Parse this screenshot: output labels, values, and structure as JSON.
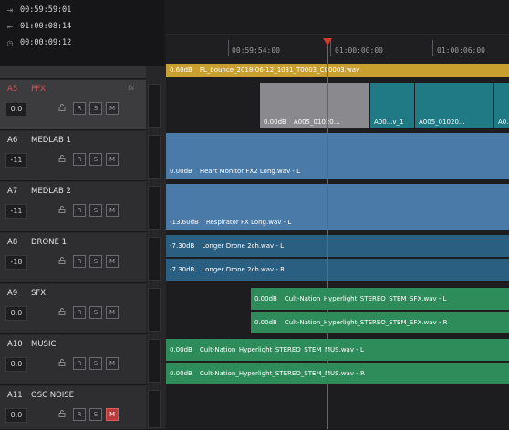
{
  "timecodes": [
    {
      "icon": "out-point-icon",
      "value": "00:59:59:01"
    },
    {
      "icon": "in-point-icon",
      "value": "01:00:08:14"
    },
    {
      "icon": "duration-icon",
      "value": "00:00:09:12"
    }
  ],
  "ruler": {
    "t1": "00:59:54:00",
    "t2": "01:00:00:00",
    "t3": "01:00:06:00"
  },
  "tracks": [
    {
      "id": "A5",
      "name": "PFX",
      "vol": "0.0",
      "fx": "fx",
      "selected": true,
      "mute_on": false
    },
    {
      "id": "A6",
      "name": "MEDLAB 1",
      "vol": "-11",
      "mute_on": false
    },
    {
      "id": "A7",
      "name": "MEDLAB 2",
      "vol": "-11",
      "mute_on": false
    },
    {
      "id": "A8",
      "name": "DRONE 1",
      "vol": "-18",
      "mute_on": false
    },
    {
      "id": "A9",
      "name": "SFX",
      "vol": "0.0",
      "mute_on": false
    },
    {
      "id": "A10",
      "name": "MUSIC",
      "vol": "0.0",
      "mute_on": false
    },
    {
      "id": "A11",
      "name": "OSC NOISE",
      "vol": "0.0",
      "mute_on": true
    }
  ],
  "buttons": {
    "r": "R",
    "s": "S",
    "m": "M"
  },
  "clips": {
    "bounce": {
      "db": "0.60dB",
      "name": "FL_bounce_2018-06-12_1031_T0003_C00003.wav"
    },
    "pfx_a": {
      "db": "0.00dB",
      "name": "A005_01020..."
    },
    "pfx_b": {
      "name": "A00...v_1"
    },
    "pfx_c": {
      "name": "A005_01020..."
    },
    "pfx_d": {
      "name": "A0..."
    },
    "medlab1": {
      "db": "0.00dB",
      "name": "Heart Monitor FX2 Long.wav - L"
    },
    "medlab2": {
      "db": "-13.60dB",
      "name": "Respirator FX Long.wav - L"
    },
    "drone_l": {
      "db": "-7.30dB",
      "name": "Longer Drone 2ch.wav - L"
    },
    "drone_r": {
      "db": "-7.30dB",
      "name": "Longer Drone 2ch.wav - R"
    },
    "sfx_l": {
      "db": "0.00dB",
      "name": "Cult-Nation_Hyperlight_STEREO_STEM_SFX.wav - L"
    },
    "sfx_r": {
      "db": "0.00dB",
      "name": "Cult-Nation_Hyperlight_STEREO_STEM_SFX.wav - R"
    },
    "mus_l": {
      "db": "0.00dB",
      "name": "Cult-Nation_Hyperlight_STEREO_STEM_MUS.wav - L"
    },
    "mus_r": {
      "db": "0.00dB",
      "name": "Cult-Nation_Hyperlight_STEREO_STEM_MUS.wav - R"
    }
  },
  "colors": {
    "yellow": "#c8a030",
    "blue": "#4a7aa8",
    "teal": "#1f7a86",
    "green": "#2e8c5a",
    "playhead": "#d23a2a"
  }
}
